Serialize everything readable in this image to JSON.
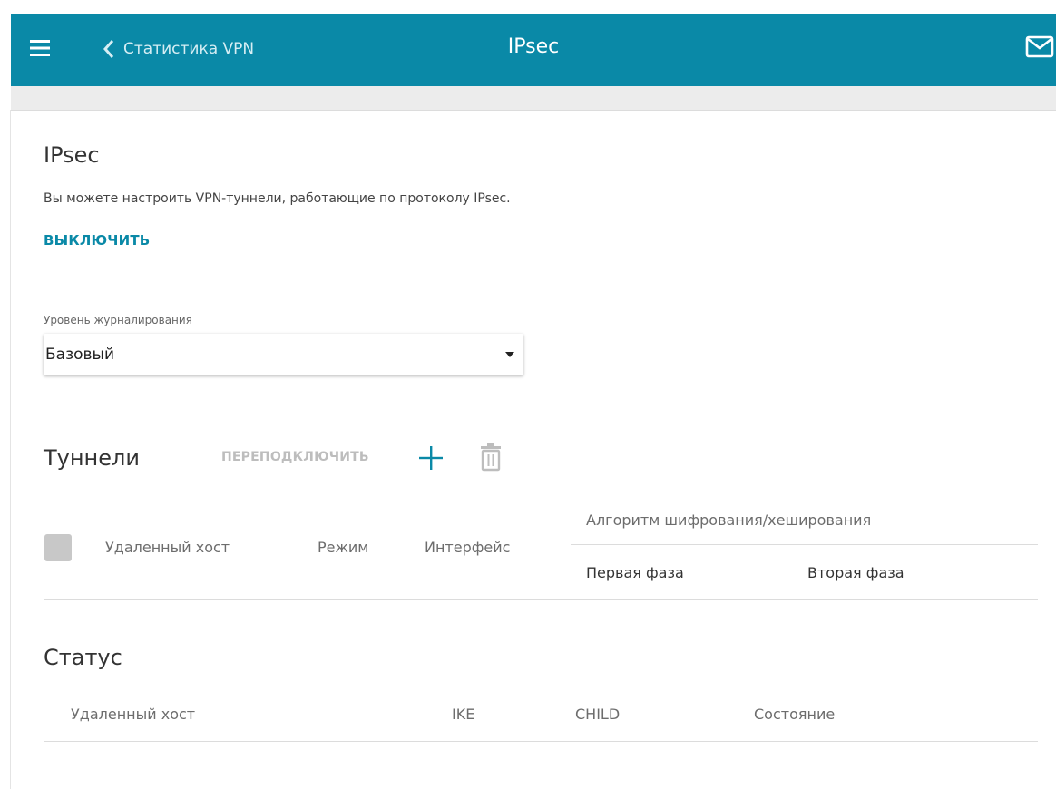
{
  "header": {
    "back_label": "Статистика VPN",
    "title": "IPsec"
  },
  "section": {
    "title": "IPsec",
    "description": "Вы можете настроить VPN-туннели, работающие по протоколу IPsec.",
    "toggle_label": "ВЫКЛЮЧИТЬ"
  },
  "log_level": {
    "label": "Уровень журналирования",
    "value": "Базовый"
  },
  "tunnels": {
    "title": "Туннели",
    "reconnect_label": "ПЕРЕПОДКЛЮЧИТЬ",
    "columns": {
      "remote_host": "Удаленный хост",
      "mode": "Режим",
      "interface": "Интерфейс",
      "algorithm": "Алгоритм шифрования/хеширования",
      "phase1": "Первая фаза",
      "phase2": "Вторая фаза"
    }
  },
  "status": {
    "title": "Статус",
    "columns": {
      "remote_host": "Удаленный хост",
      "ike": "IKE",
      "child": "CHILD",
      "state": "Состояние"
    }
  },
  "colors": {
    "accent": "#0a89a7",
    "header_bg": "#0a89a7",
    "disabled": "#bdbdbd",
    "checkbox": "#c8c8c8"
  },
  "icons": [
    "menu-icon",
    "chevron-left-icon",
    "mail-icon",
    "plus-icon",
    "trash-icon",
    "caret-down-icon"
  ]
}
